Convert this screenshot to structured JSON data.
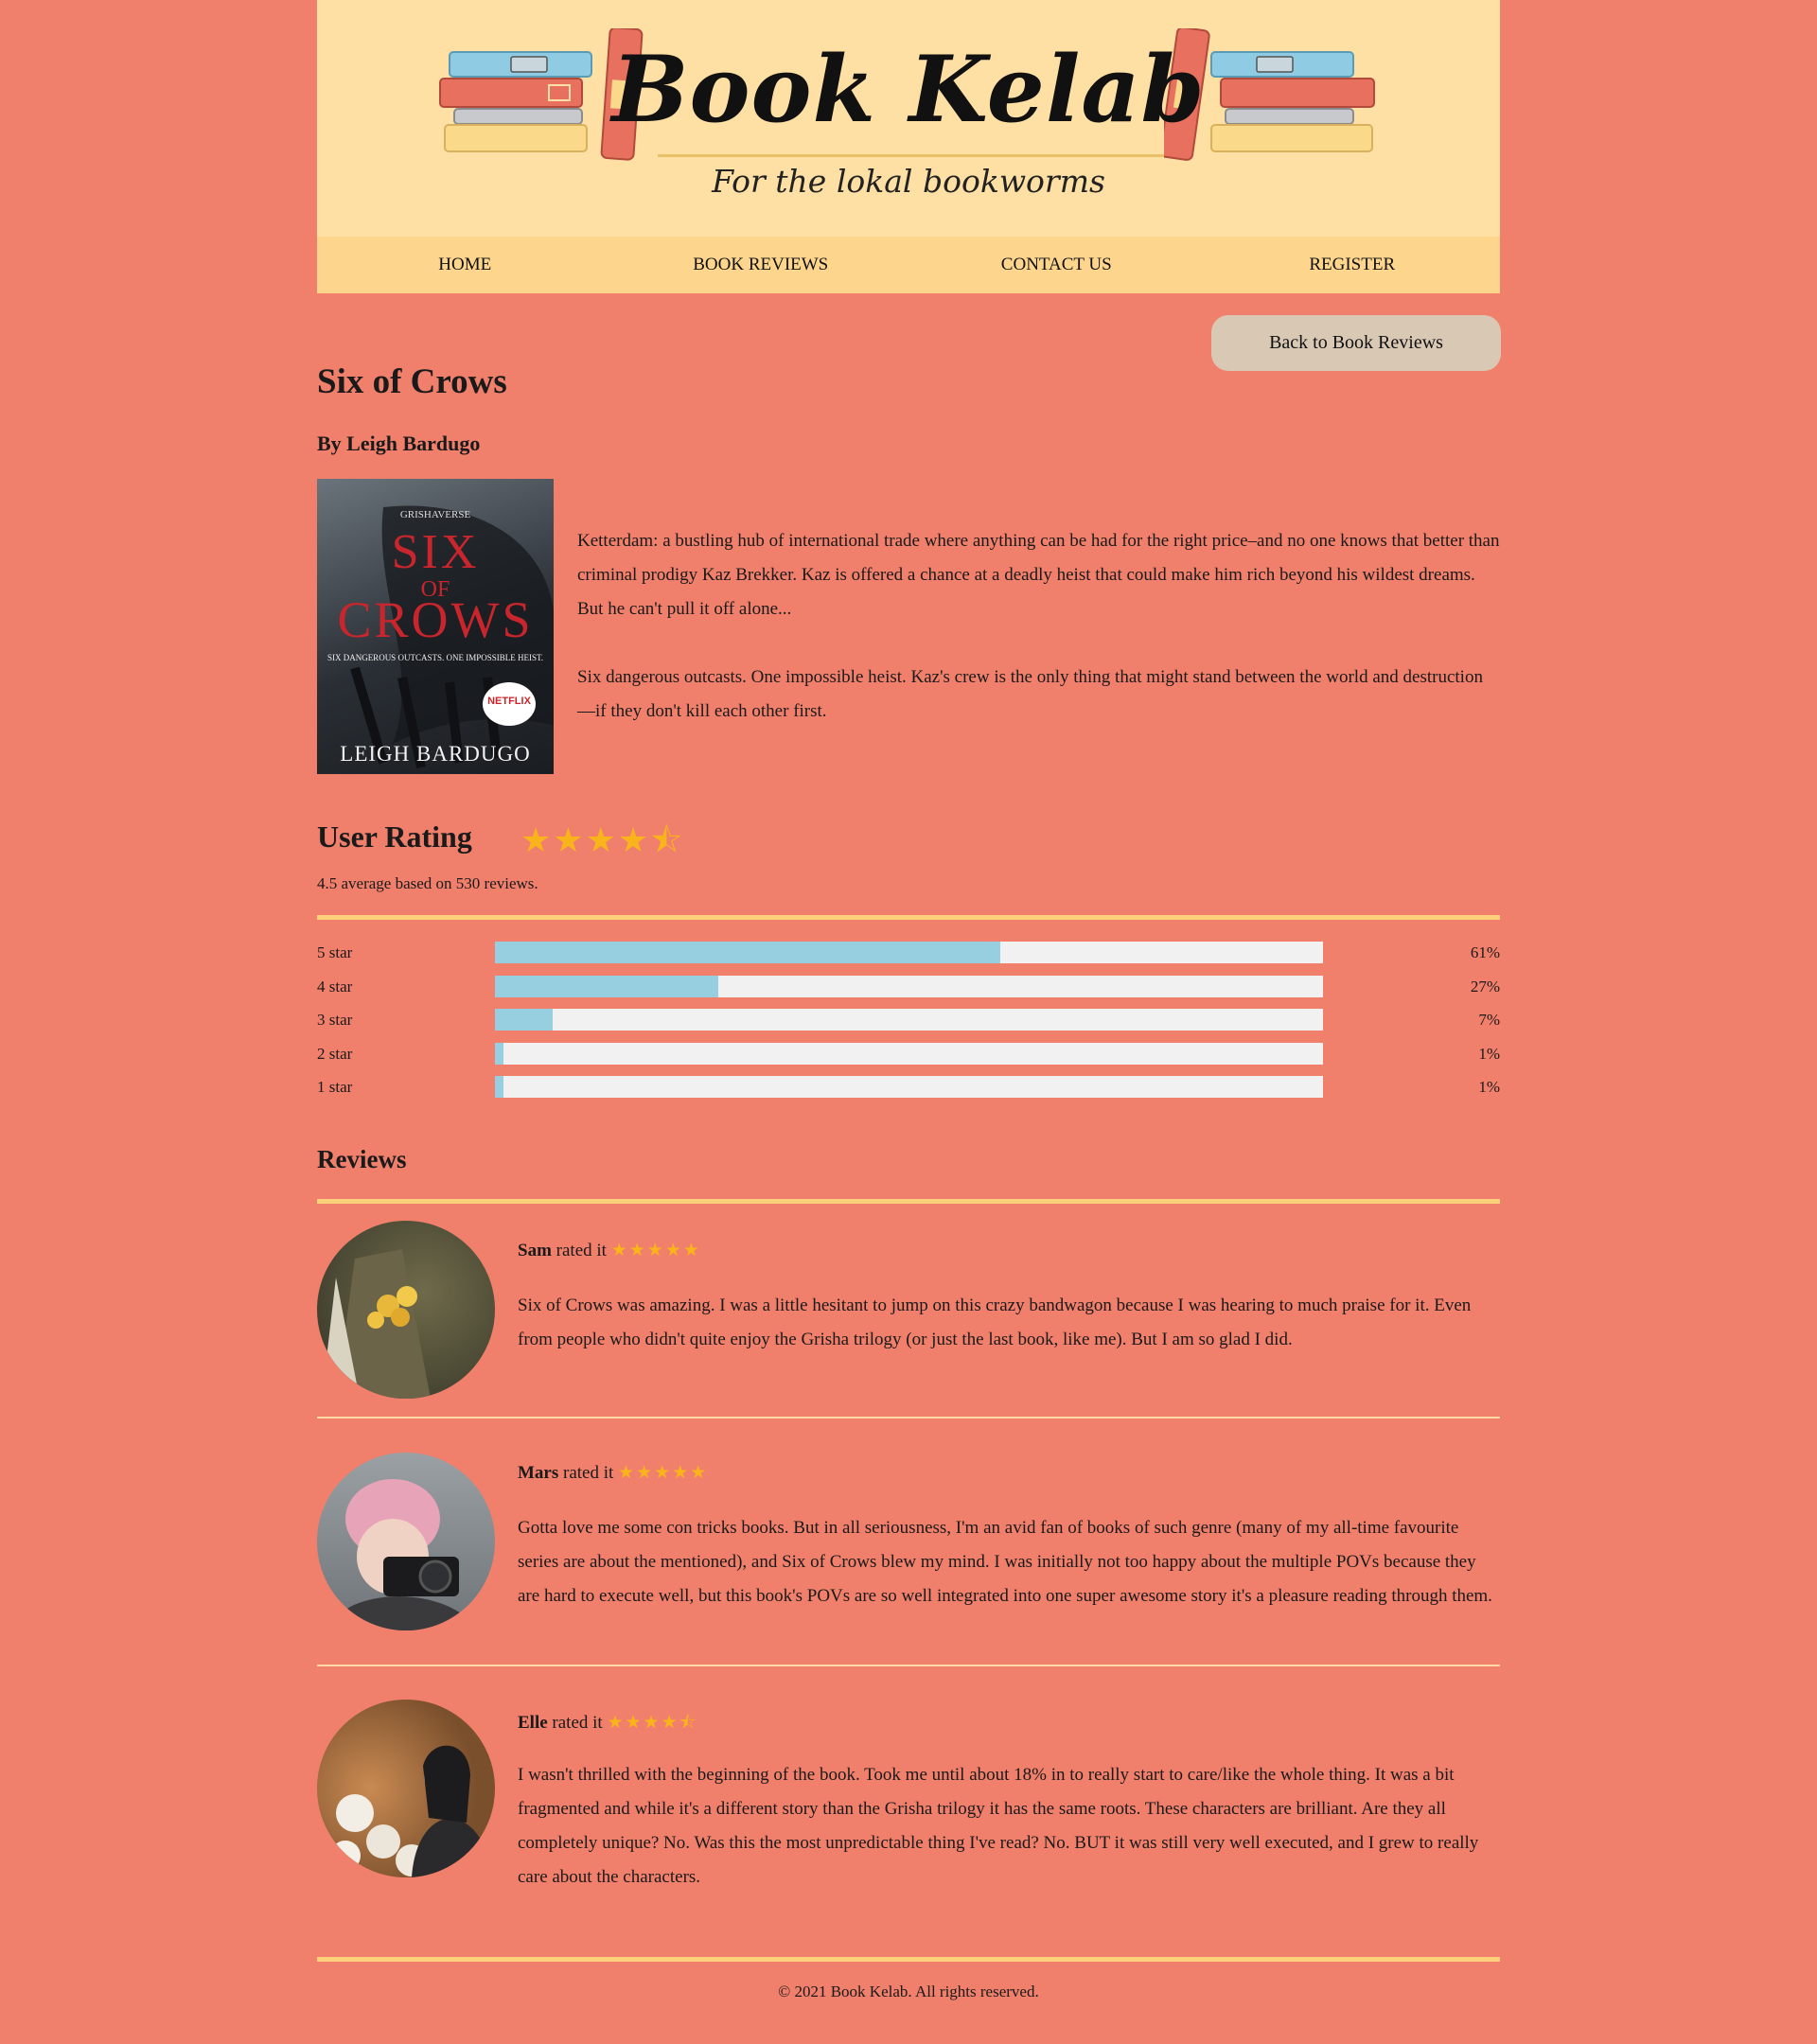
{
  "brand": {
    "title": "Book Kelab",
    "tagline": "For the lokal bookworms"
  },
  "nav": [
    "HOME",
    "BOOK REVIEWS",
    "CONTACT US",
    "REGISTER"
  ],
  "back_button": "Back to Book Reviews",
  "book": {
    "title": "Six of Crows",
    "author": "By Leigh Bardugo",
    "cover": {
      "series": "GRISHAVERSE",
      "word1": "SIX",
      "word2": "OF",
      "word3": "CROWS",
      "tagline": "SIX DANGEROUS OUTCASTS. ONE IMPOSSIBLE HEIST.",
      "badge": "NETFLIX",
      "author": "LEIGH BARDUGO"
    },
    "description": [
      "Ketterdam: a bustling hub of international trade where anything can be had for the right price–and no one knows that better than criminal prodigy Kaz Brekker. Kaz is offered a chance at a deadly heist that could make him rich beyond his wildest dreams. But he can't pull it off alone...",
      "Six dangerous outcasts. One impossible heist. Kaz's crew is the only thing that might stand between the world and destruction—if they don't kill each other first."
    ]
  },
  "rating": {
    "heading": "User Rating",
    "stars": 4.5,
    "summary": "4.5 average based on 530 reviews.",
    "breakdown": [
      {
        "label": "5 star",
        "percent": 61,
        "percent_label": "61%"
      },
      {
        "label": "4 star",
        "percent": 27,
        "percent_label": "27%"
      },
      {
        "label": "3 star",
        "percent": 7,
        "percent_label": "7%"
      },
      {
        "label": "2 star",
        "percent": 1,
        "percent_label": "1%"
      },
      {
        "label": "1 star",
        "percent": 1,
        "percent_label": "1%"
      }
    ],
    "bar_color": "#97cfe0"
  },
  "reviews_heading": "Reviews",
  "rated_text": "rated it",
  "reviews": [
    {
      "name": "Sam",
      "stars": 5,
      "text": "Six of Crows was amazing. I was a little hesitant to jump on this crazy bandwagon because I was hearing to much praise for it. Even from people who didn't quite enjoy the Grisha trilogy (or just the last book, like me). But I am so glad I did."
    },
    {
      "name": "Mars",
      "stars": 5,
      "text": "Gotta love me some con tricks books. But in all seriousness, I'm an avid fan of books of such genre (many of my all-time favourite series are about the mentioned), and Six of Crows blew my mind. I was initially not too happy about the multiple POVs because they are hard to execute well, but this book's POVs are so well integrated into one super awesome story it's a pleasure reading through them."
    },
    {
      "name": "Elle",
      "stars": 4.5,
      "text": "I wasn't thrilled with the beginning of the book. Took me until about 18% in to really start to care/like the whole thing. It was a bit fragmented and while it's a different story than the Grisha trilogy it has the same roots. These characters are brilliant. Are they all completely unique? No. Was this the most unpredictable thing I've read? No. BUT it was still very well executed, and I grew to really care about the characters."
    }
  ],
  "footer": "© 2021 Book Kelab. All rights reserved.",
  "colors": {
    "page_bg": "#f07f6b",
    "banner_bg": "#ffe0a4",
    "nav_bg": "#fdd58d",
    "star": "#f9b41b"
  }
}
